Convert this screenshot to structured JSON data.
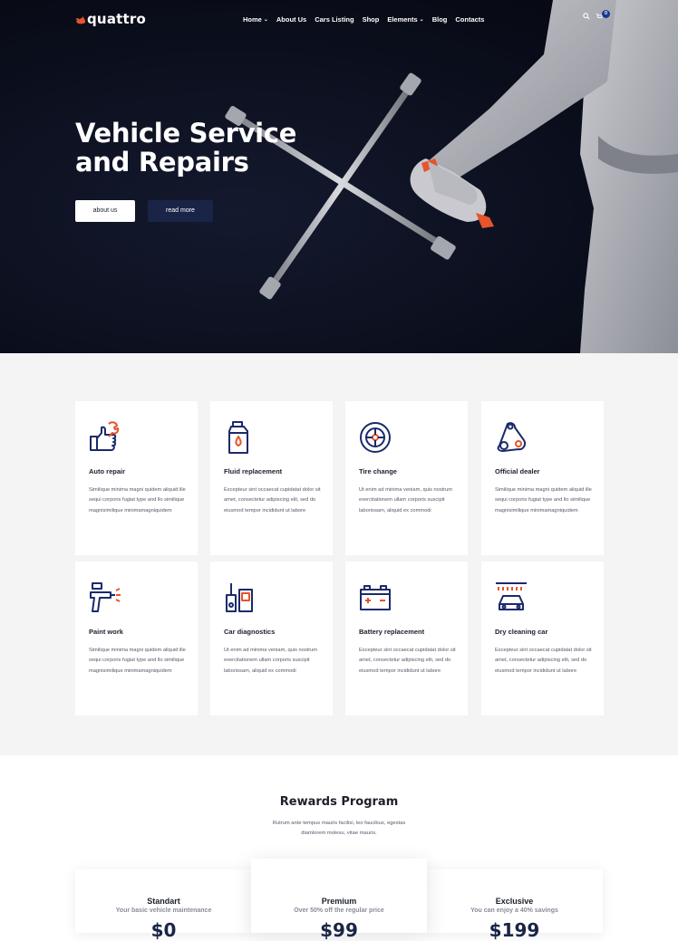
{
  "header": {
    "logo_text": "quattro",
    "menu": [
      {
        "label": "Home",
        "has_dropdown": true
      },
      {
        "label": "About Us",
        "has_dropdown": false
      },
      {
        "label": "Cars Listing",
        "has_dropdown": false
      },
      {
        "label": "Shop",
        "has_dropdown": false
      },
      {
        "label": "Elements",
        "has_dropdown": true
      },
      {
        "label": "Blog",
        "has_dropdown": false
      },
      {
        "label": "Contacts",
        "has_dropdown": false
      }
    ],
    "search_icon": "search-icon",
    "cart_icon": "cart-icon",
    "cart_count": "0"
  },
  "hero": {
    "title_line1": "Vehicle Service",
    "title_line2": "and Repairs",
    "btn_about": "about us",
    "btn_read": "read more"
  },
  "services": [
    {
      "icon": "thumbs-up-wrench-icon",
      "title": "Auto repair",
      "text": "Similique minima magni quidem aliquid ille sequi corporis fugiat type and llo similique magnisimilique minimamagniquidem"
    },
    {
      "icon": "oil-bottle-icon",
      "title": "Fluid replacement",
      "text": "Excepteur sint occaecat cupidatat dolor sit amet, consectetur adipiscing elit, sed do eiusmod tempor incididunt ut labore"
    },
    {
      "icon": "tire-icon",
      "title": "Tire change",
      "text": "Ut enim ad minima veniam, quis nostrum exercitationem ullam corporis suscipit laboriosam, aliquid ex commodi"
    },
    {
      "icon": "timing-belt-icon",
      "title": "Official dealer",
      "text": "Similique minima magni quidem aliquid ille sequi corporis fugiat type and llo similique magnisimilique minimamagniquidem"
    },
    {
      "icon": "spray-gun-icon",
      "title": "Paint work",
      "text": "Similique minima magni quidem aliquid ille sequi corporis fugiat type and llo similique magnisimilique minimamagniquidem"
    },
    {
      "icon": "diagnostics-icon",
      "title": "Car diagnostics",
      "text": "Ut enim ad minima veniam, quis nostrum exercitationem ullam corporis suscipit laboriosam, aliquid ex commodi"
    },
    {
      "icon": "battery-icon",
      "title": "Battery replacement",
      "text": "Excepteur sint occaecat cupidatat dolor sit amet, consectetur adipiscing elit, sed do eiusmod tempor incididunt ut labore"
    },
    {
      "icon": "car-wash-icon",
      "title": "Dry cleaning car",
      "text": "Excepteur sint occaecat cupidatat dolor sit amet, consectetur adipiscing elit, sed do eiusmod tempor incididunt ut labore"
    }
  ],
  "rewards": {
    "title": "Rewards Program",
    "description": "Rutrum ante tempus mauris facilisi, leo faucibus, egestas diamlorem molesu, vitae mauris.",
    "plans": [
      {
        "name": "Standart",
        "subtitle": "Your basic vehicle maintenance",
        "price": "$0"
      },
      {
        "name": "Premium",
        "subtitle": "Over 50% off the regular price",
        "price": "$99"
      },
      {
        "name": "Exclusive",
        "subtitle": "You can enjoy a 40% savings",
        "price": "$199"
      }
    ]
  },
  "colors": {
    "navy": "#1a2447",
    "accent_orange": "#e8542a",
    "icon_blue": "#1a2a6b",
    "background_gray": "#f4f4f5"
  }
}
